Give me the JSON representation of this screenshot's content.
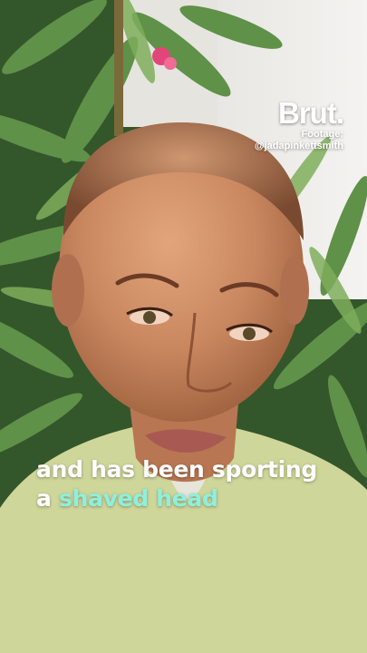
{
  "brand": {
    "logo": "Brut.",
    "credit_label": "Footage:",
    "credit_handle": "@jadapinkettsmith"
  },
  "caption": {
    "line1": "and has been sporting",
    "line2_prefix": "a",
    "line2_highlight": "shaved head"
  },
  "colors": {
    "caption_text": "#ffffff",
    "caption_highlight": "#8ef0dc",
    "sweater": "#cfd69a",
    "foliage": "#4f7d3a"
  }
}
